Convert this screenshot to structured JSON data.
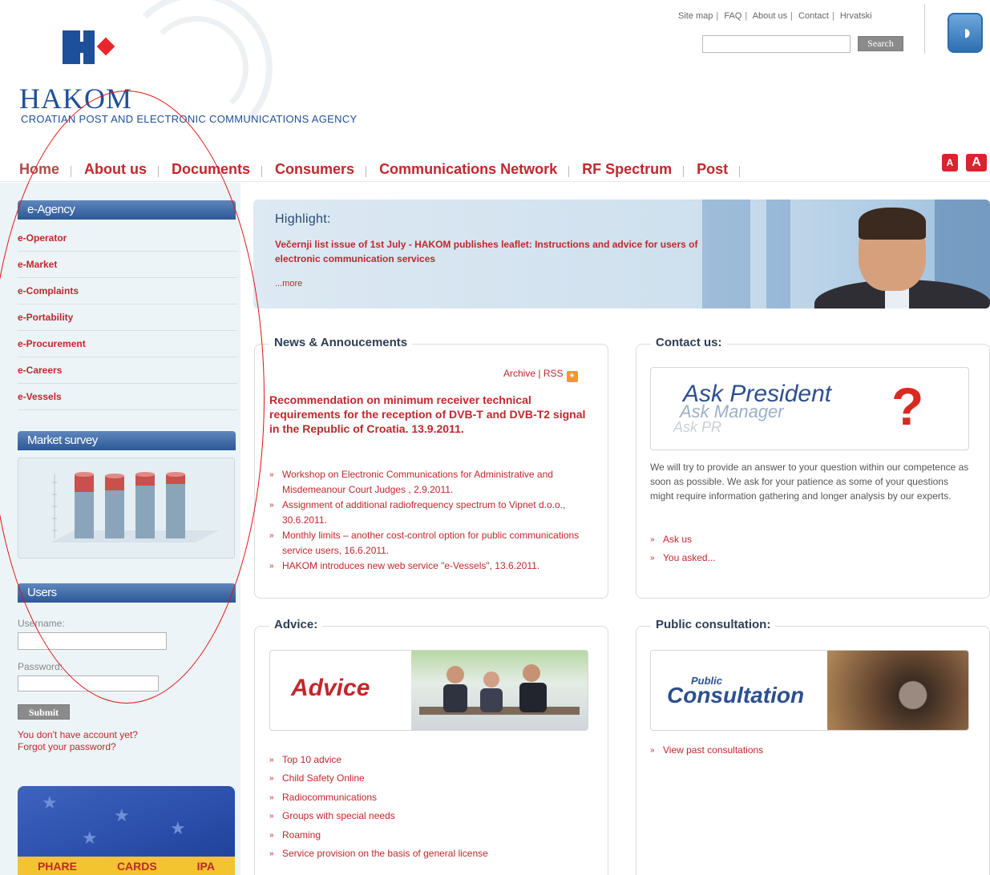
{
  "header": {
    "brand": "HAKOM",
    "tagline": "CROATIAN POST AND ELECTRONIC COMMUNICATIONS AGENCY",
    "toplinks": [
      "Site map",
      "FAQ",
      "About us",
      "Contact",
      "Hrvatski"
    ],
    "search_button": "Search",
    "search_placeholder": "",
    "accessibility_icon": "accessibility-icon"
  },
  "nav": [
    "Home",
    "About us",
    "Documents",
    "Consumers",
    "Communications Network",
    "RF Spectrum",
    "Post"
  ],
  "font_size": {
    "small": "A",
    "large": "A"
  },
  "sidebar": {
    "eagency_title": "e-Agency",
    "eagency_items": [
      "e-Operator",
      "e-Market",
      "e-Complaints",
      "e-Portability",
      "e-Procurement",
      "e-Careers",
      "e-Vessels"
    ],
    "survey_title": "Market survey",
    "users_title": "Users",
    "username_label": "Username:",
    "password_label": "Password:",
    "submit_label": "Submit",
    "no_account": "You don't have account yet?",
    "forgot": "Forgot your password?",
    "eu_labels": [
      "PHARE",
      "CARDS",
      "IPA"
    ]
  },
  "highlight": {
    "title": "Highlight:",
    "text": "Večernji list issue of 1st July - HAKOM publishes leaflet: Instructions and advice for users of electronic communication services",
    "more": "...more"
  },
  "news": {
    "title": "News & Annoucements",
    "archive": "Archive",
    "rss": "RSS",
    "headline": "Recommendation on minimum receiver technical requirements for the reception of DVB-T and DVB-T2 signal in the Republic of Croatia. 13.9.2011.",
    "items": [
      "Workshop on Electronic Communications for Administrative and Misdemeanour Court Judges , 2.9.2011.",
      "Assignment of additional radiofrequency spectrum to Vipnet d.o.o., 30.6.2011.",
      "Monthly limits – another cost-control option for public communications service users, 16.6.2011.",
      "HAKOM introduces new web service \"e-Vessels\", 13.6.2011."
    ]
  },
  "contact": {
    "title": "Contact us:",
    "banner_main": "Ask President",
    "banner_second": "Ask Manager",
    "banner_third": "Ask PR",
    "text": "We will try to provide an answer to your question within our competence as soon as possible. We ask for your patience as some of your questions might require information gathering and longer analysis by our experts.",
    "links": [
      "Ask us",
      "You asked..."
    ]
  },
  "advice": {
    "title": "Advice:",
    "banner": "Advice",
    "items": [
      "Top 10 advice",
      "Child Safety Online",
      "Radiocommunications",
      "Groups with special needs",
      "Roaming",
      "Service provision on the basis of general license"
    ]
  },
  "consultation": {
    "title": "Public consultation:",
    "banner_small": "Public",
    "banner_big": "Consultation",
    "links": [
      "View past consultations"
    ]
  }
}
